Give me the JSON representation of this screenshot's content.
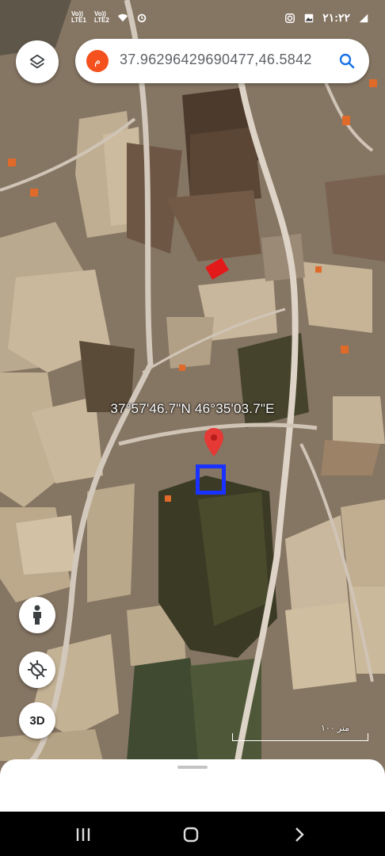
{
  "status_bar": {
    "network_labels": [
      "Vo))\nLTE1",
      "Vo))\nLTE2"
    ],
    "time": "۲۱:۲۲",
    "icons": [
      "wifi-icon",
      "alarm-icon",
      "instagram-icon",
      "gallery-icon",
      "triangle-icon"
    ]
  },
  "search": {
    "avatar_letter": "م",
    "query": "37.96296429690477,46.5842",
    "icon": "search-icon"
  },
  "layers_button": {
    "icon": "layers-icon"
  },
  "map": {
    "coordinate_label": "37°57'46.7\"N 46°35'03.7\"E",
    "scale_label": "۱۰۰ متر",
    "pin_color": "#e53935",
    "highlight_color": "#1a32ff"
  },
  "map_controls": {
    "street_view": "person-icon",
    "location": "gps-off-icon",
    "three_d_label": "3D"
  },
  "nav_bar": {
    "buttons": [
      "recents-icon",
      "home-icon",
      "back-icon"
    ]
  }
}
